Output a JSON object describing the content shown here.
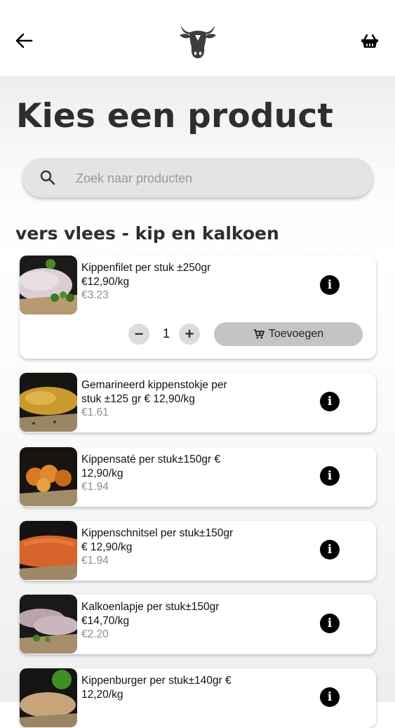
{
  "header": {
    "back_icon": "arrow-left-icon",
    "logo_icon": "cow-head-icon",
    "basket_icon": "shopping-basket-icon"
  },
  "page": {
    "title": "Kies een product"
  },
  "search": {
    "placeholder": "Zoek naar producten",
    "value": ""
  },
  "category": {
    "title": "vers vlees - kip en kalkoen"
  },
  "products": [
    {
      "name_lines": [
        "Kippenfilet per stuk ±250gr",
        "€12,90/kg"
      ],
      "price": "€3.23",
      "expanded": true,
      "quantity": "1",
      "add_label": "Toevoegen"
    },
    {
      "name_lines": [
        "Gemarineerd kippenstokje per",
        "stuk ±125 gr € 12,90/kg"
      ],
      "price": "€1.61"
    },
    {
      "name_lines": [
        "Kippensaté per stuk±150gr €",
        "12,90/kg"
      ],
      "price": "€1.94"
    },
    {
      "name_lines": [
        "Kippenschnitsel per stuk±150gr",
        "€ 12,90/kg"
      ],
      "price": "€1.94"
    },
    {
      "name_lines": [
        "Kalkoenlapje per stuk±150gr",
        "€14,70/kg"
      ],
      "price": "€2.20"
    },
    {
      "name_lines": [
        "Kippenburger per stuk±140gr €",
        "12,20/kg"
      ],
      "price": ""
    }
  ],
  "controls": {
    "minus_label": "−",
    "plus_label": "+",
    "info_label": "i",
    "cart_icon": "cart-plus-icon",
    "info_icon": "info-icon"
  },
  "colors": {
    "title_text": "#2e2e2e",
    "price_grey": "#8e8e8e",
    "search_bg": "#e4e4e6",
    "button_grey": "#c4c4c6"
  }
}
